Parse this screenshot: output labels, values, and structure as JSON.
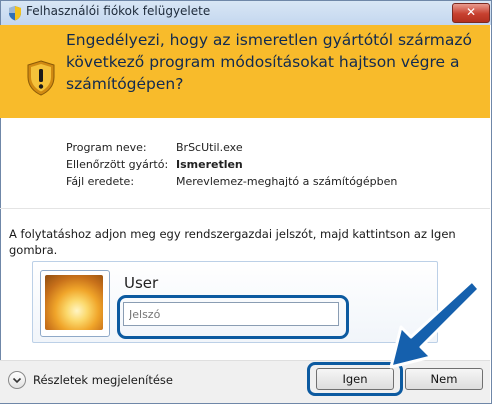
{
  "titlebar": {
    "title": "Felhasználói fiókok felügyelete",
    "close_label": "✕"
  },
  "banner": {
    "message": "Engedélyezi, hogy az ismeretlen gyártótól származó következő program módosításokat hajtson végre a számítógépen?",
    "color": "#f8bb2b"
  },
  "details": {
    "rows": [
      {
        "label": "Program neve:",
        "value": "BrScUtil.exe"
      },
      {
        "label": "Ellenőrzött gyártó:",
        "value": "Ismeretlen"
      },
      {
        "label": "Fájl eredete:",
        "value": "Merevlemez-meghajtó a számítógépben"
      }
    ]
  },
  "credentials": {
    "instruction": "A folytatáshoz adjon meg egy rendszergazdai jelszót, majd kattintson az Igen gombra.",
    "username": "User",
    "password_placeholder": "Jelszó"
  },
  "footer": {
    "details_label": "Részletek megjelenítése",
    "yes_label": "Igen",
    "no_label": "Nem"
  },
  "colors": {
    "highlight": "#0c5aa0",
    "arrow": "#1560ad"
  }
}
